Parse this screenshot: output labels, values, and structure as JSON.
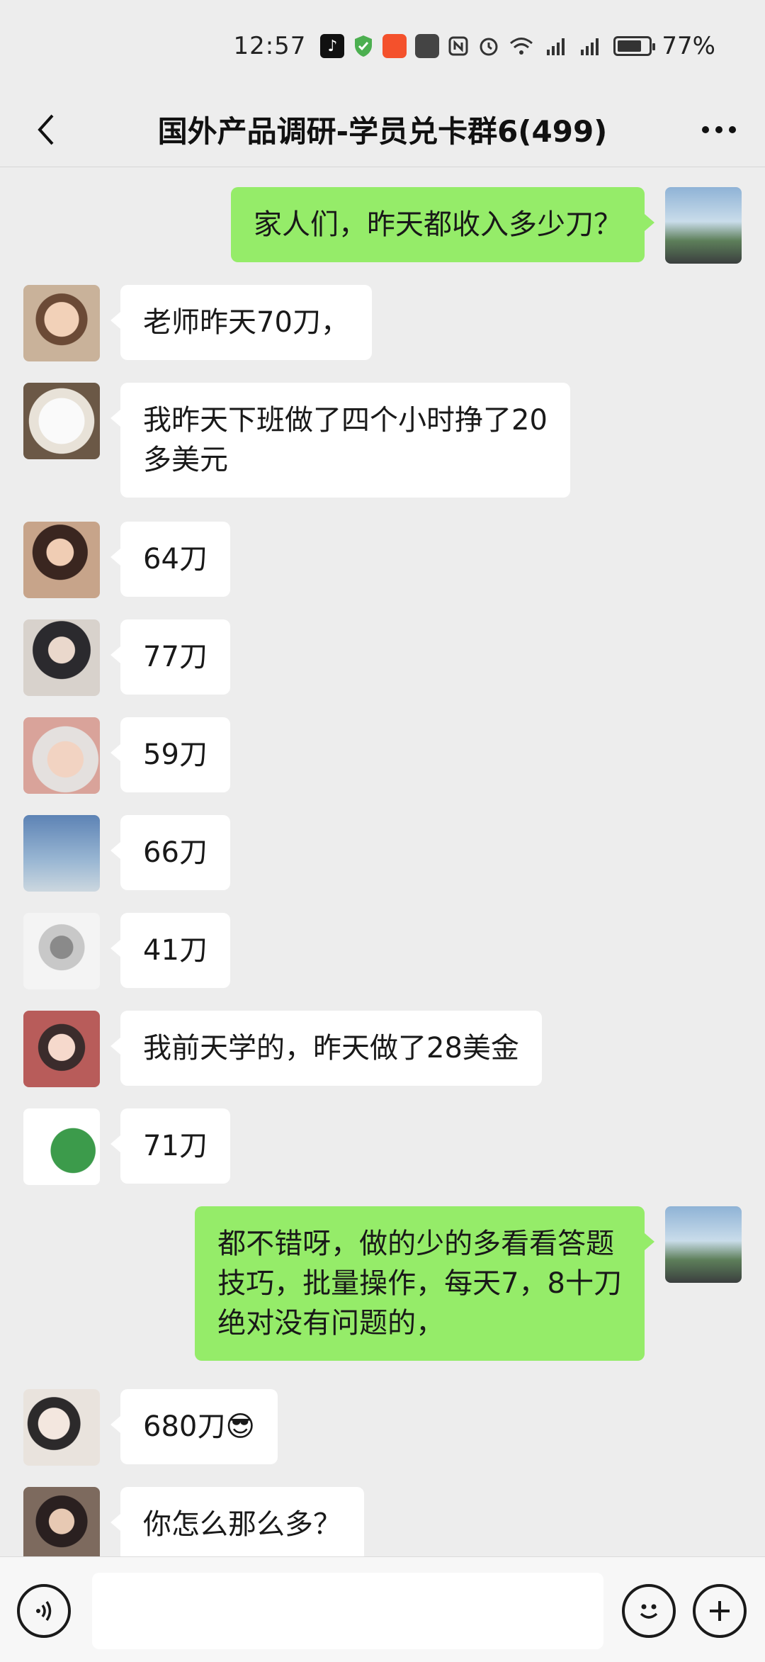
{
  "status_bar": {
    "time": "12:57",
    "battery_percent": "77%",
    "battery_level": 0.77,
    "icons": [
      "tiktok-icon",
      "shield-check-icon",
      "app-orange-icon",
      "app-bag-icon",
      "nfc-icon",
      "alarm-icon",
      "wifi-icon",
      "signal-5g-icon",
      "signal-5g-icon",
      "battery-icon"
    ]
  },
  "header": {
    "title": "国外产品调研-学员兑卡群6(499)",
    "back_icon": "chevron-left-icon",
    "more_icon": "more-dots-icon"
  },
  "messages": [
    {
      "side": "right",
      "avatar": "car-mirror",
      "text": "家人们，昨天都收入多少刀？"
    },
    {
      "side": "left",
      "avatar": "kid",
      "text": "老师昨天70刀，"
    },
    {
      "side": "left",
      "avatar": "dog",
      "text": "我昨天下班做了四个小时挣了20\n多美元"
    },
    {
      "side": "left",
      "avatar": "girl",
      "text": "64刀"
    },
    {
      "side": "left",
      "avatar": "boy",
      "text": "77刀"
    },
    {
      "side": "left",
      "avatar": "baby",
      "text": "59刀"
    },
    {
      "side": "left",
      "avatar": "sky",
      "text": "66刀"
    },
    {
      "side": "left",
      "avatar": "mask",
      "text": "41刀"
    },
    {
      "side": "left",
      "avatar": "girl-2",
      "text": "我前天学的，昨天做了28美金"
    },
    {
      "side": "left",
      "avatar": "crocodile",
      "text": "71刀"
    },
    {
      "side": "right",
      "avatar": "car-mirror",
      "text": "都不错呀，做的少的多看看答题\n技巧，批量操作，每天7，8十刀\n绝对没有问题的，"
    },
    {
      "side": "left",
      "avatar": "comic",
      "text": "680刀😎"
    },
    {
      "side": "left",
      "avatar": "girl-3",
      "text": "你怎么那么多？"
    }
  ],
  "input_bar": {
    "text_value": "",
    "voice_icon": "voice-icon",
    "emoji_icon": "emoji-icon",
    "plus_icon": "plus-icon"
  }
}
